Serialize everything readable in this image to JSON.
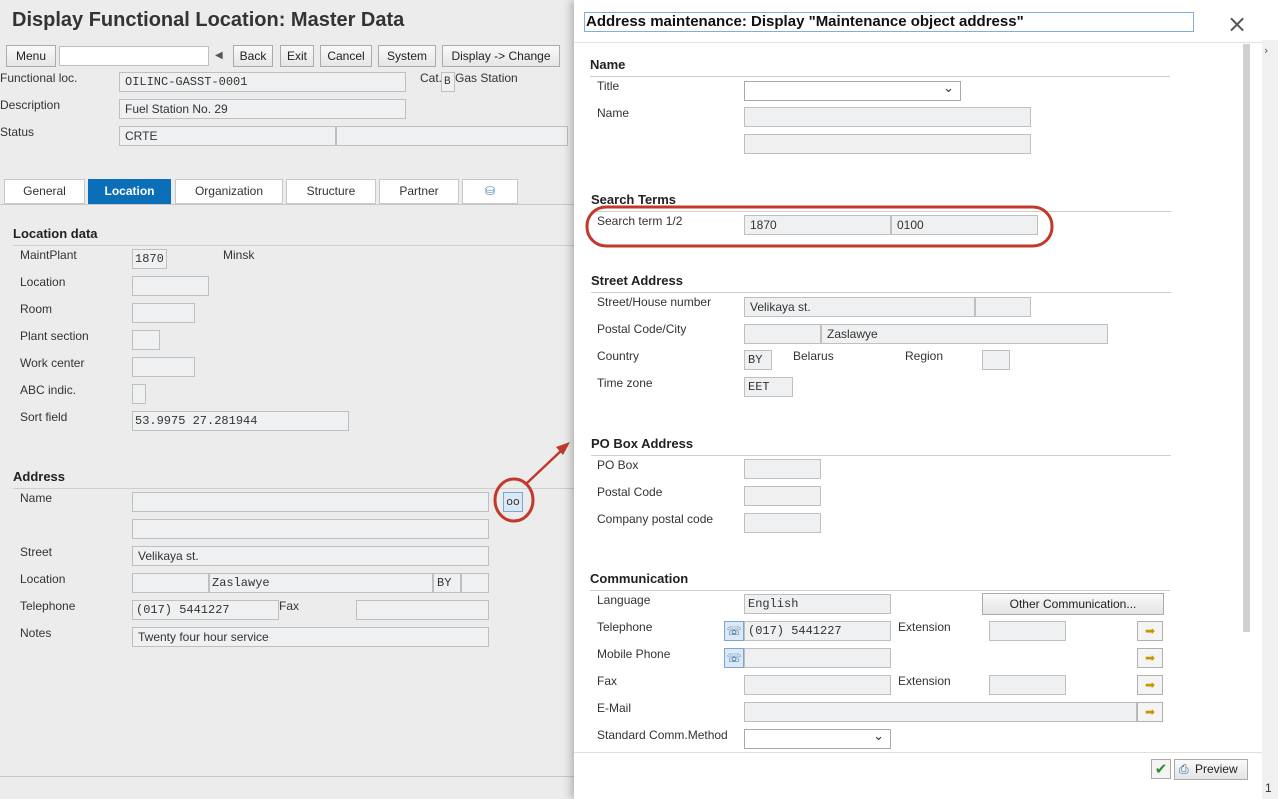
{
  "main": {
    "title": "Display Functional Location: Master Data",
    "toolbar": {
      "menu": "Menu",
      "back": "Back",
      "exit": "Exit",
      "cancel": "Cancel",
      "system": "System",
      "display_change": "Display -> Change"
    },
    "header": {
      "func_loc_label": "Functional loc.",
      "func_loc_value": "OILINC-GASST-0001",
      "cat_label": "Cat.",
      "cat_value": "B",
      "cat_text": "Gas Station",
      "desc_label": "Description",
      "desc_value": "Fuel Station No. 29",
      "status_label": "Status",
      "status_value": "CRTE"
    },
    "tabs": [
      "General",
      "Location",
      "Organization",
      "Structure",
      "Partner"
    ],
    "location_data": {
      "title": "Location data",
      "maint_plant_label": "MaintPlant",
      "maint_plant_value": "1870",
      "maint_plant_text": "Minsk",
      "location_label": "Location",
      "room_label": "Room",
      "plant_section_label": "Plant section",
      "work_center_label": "Work center",
      "abc_label": "ABC indic.",
      "sort_field_label": "Sort field",
      "sort_field_value": "53.9975 27.281944"
    },
    "address": {
      "title": "Address",
      "name_label": "Name",
      "street_label": "Street",
      "street_value": "Velikaya st.",
      "location_label": "Location",
      "city_value": "Zaslawye",
      "country_value": "BY",
      "telephone_label": "Telephone",
      "telephone_value": "(017) 5441227",
      "fax_label": "Fax",
      "notes_label": "Notes",
      "notes_value": "Twenty four hour service"
    }
  },
  "dialog": {
    "title": "Address maintenance: Display \"Maintenance object address\"",
    "name_section": "Name",
    "title_label": "Title",
    "name_label": "Name",
    "search_section": "Search Terms",
    "search_label": "Search term 1/2",
    "search1": "1870",
    "search2": "0100",
    "street_section": "Street Address",
    "street_label": "Street/House number",
    "street_value": "Velikaya st.",
    "postal_city_label": "Postal Code/City",
    "city_value": "Zaslawye",
    "country_label": "Country",
    "country_value": "BY",
    "country_text": "Belarus",
    "region_label": "Region",
    "timezone_label": "Time zone",
    "timezone_value": "EET",
    "pobox_section": "PO Box Address",
    "pobox_label": "PO Box",
    "postal_code_label": "Postal Code",
    "company_postal_label": "Company postal code",
    "comm_section": "Communication",
    "language_label": "Language",
    "language_value": "English",
    "other_comm": "Other Communication...",
    "telephone_label": "Telephone",
    "telephone_value": "(017) 5441227",
    "extension_label": "Extension",
    "mobile_label": "Mobile Phone",
    "fax_label": "Fax",
    "fax_ext_label": "Extension",
    "email_label": "E-Mail",
    "std_comm_label": "Standard Comm.Method",
    "preview": "Preview",
    "close_glyph": "×"
  },
  "page_number": "1",
  "colors": {
    "accent": "#0a6fb8",
    "highlight": "#c0392b",
    "confirm": "#2e8b2e"
  }
}
